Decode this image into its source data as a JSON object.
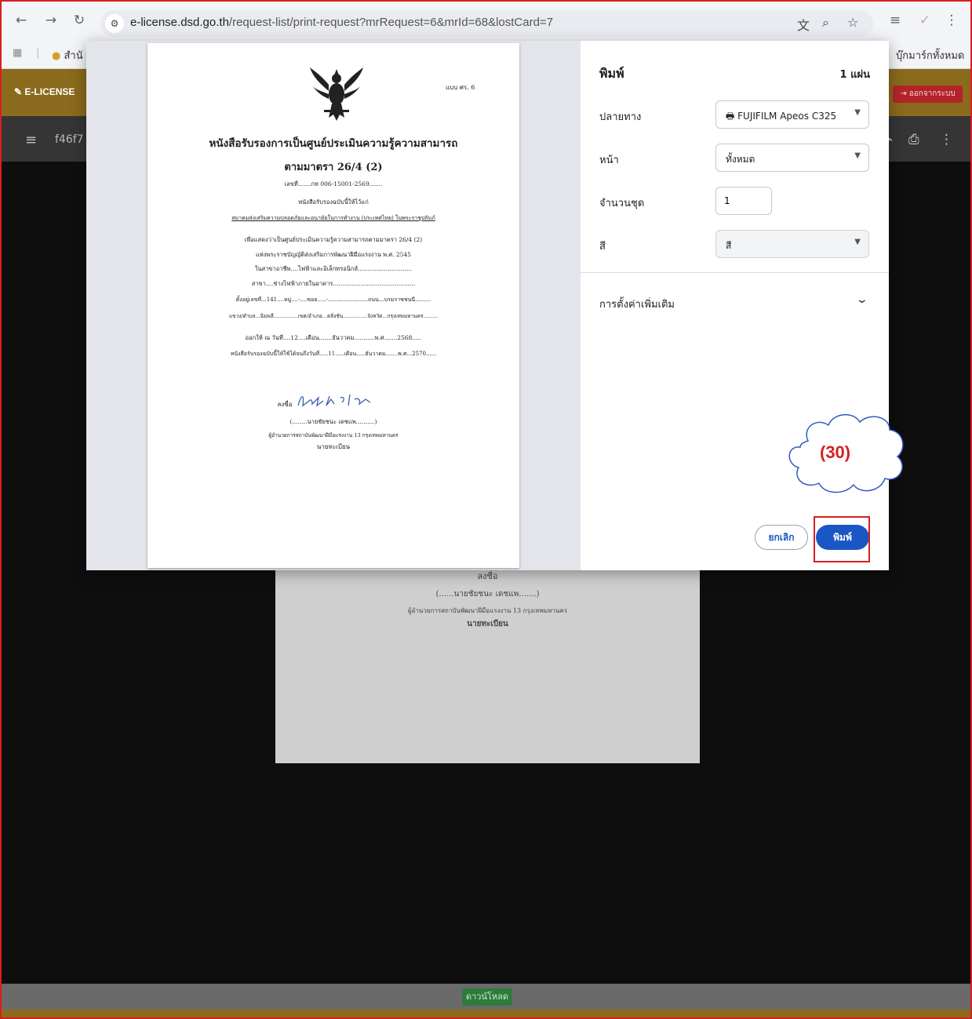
{
  "browser": {
    "url_host": "e-license.dsd.go.th",
    "url_path": "/request-list/print-request?mrRequest=6&mrId=68&lostCard=7",
    "bookmark_left": "สำนั",
    "bookmarks_all": "บุ๊กมาร์กทั้งหมด"
  },
  "site": {
    "logo": "E-LICENSE",
    "logout": "ออกจากระบบ",
    "doc_name": "f46f7",
    "download": "ดาวน์โหลด",
    "bg_sign": "ลงชื่อ",
    "bg_name": "(......นายชัยชนะ เดชแพ.......)",
    "bg_position": "ผู้อำนวยการสถาบันพัฒนาฝีมือแรงงาน 13 กรุงเทพมหานคร",
    "bg_registrar": "นายทะเบียน"
  },
  "certificate": {
    "form_code": "แบบ ศร. 6",
    "title": "หนังสือรับรองการเป็นศูนย์ประเมินความรู้ความสามารถ",
    "section": "ตามมาตรา 26/4 (2)",
    "number": "เลขที่.......กท 006-15001-2569.......",
    "issued_to": "หนังสือรับรองฉบับนี้ให้ไว้แก่",
    "org": "สมาคมส่งเสริมความปลอดภัยและอนามัยในการทำงาน (ประเทศไทย) ในพระราชูปถัมภ์",
    "purpose1": "เพื่อแสดงว่าเป็นศูนย์ประเมินความรู้ความสามารถตามมาตรา 26/4 (2)",
    "purpose2": "แห่งพระราชบัญญัติส่งเสริมการพัฒนาฝีมือแรงงาน พ.ศ. 2545",
    "occupation": "ในสาขาอาชีพ....ไฟฟ้าและอิเล็กทรอนิกส์.............................",
    "branch": "สาขา....ช่างไฟฟ้าภายในอาคาร............................................",
    "address1": "ตั้งอยู่เลขที่...141....หมู่....-....ซอย.....-.......................ถนน...บรมราชชนนี.........",
    "address2": "แขวง/ตำบล...ฉิมพลี...............เขต/อำเภอ...ตลิ่งชัน...............จังหวัด...กรุงเทพมหานคร.........",
    "issued": "ออกให้ ณ วันที่....12....เดือน.......ธันวาคม...........พ.ศ.......2568.....",
    "valid": "หนังสือรับรองฉบับนี้ให้ใช้ได้จนถึงวันที่.....11.....เดือน.....ธันวาคม.......พ.ศ...2570......",
    "sign": "ลงชื่อ",
    "signer": "(........นายชัยชนะ เดชแพ..........)",
    "position": "ผู้อำนวยการสถาบันพัฒนาฝีมือแรงงาน 13 กรุงเทพมหานคร",
    "registrar": "นายทะเบียน"
  },
  "print": {
    "title": "พิมพ์",
    "sheets": "1 แผ่น",
    "destination_label": "ปลายทาง",
    "destination_value": "FUJIFILM Apeos C325",
    "pages_label": "หน้า",
    "pages_value": "ทั้งหมด",
    "copies_label": "จำนวนชุด",
    "copies_value": "1",
    "color_label": "สี",
    "color_value": "สี",
    "more_settings": "การตั้งค่าเพิ่มเติม",
    "cancel": "ยกเลิก",
    "print": "พิมพ์"
  },
  "annotation": {
    "step": "(30)",
    "color": "#d62020"
  },
  "colors": {
    "accent_blue": "#1a56c4",
    "header_gold": "#8a6a1c",
    "logout_red": "#b3242a"
  }
}
